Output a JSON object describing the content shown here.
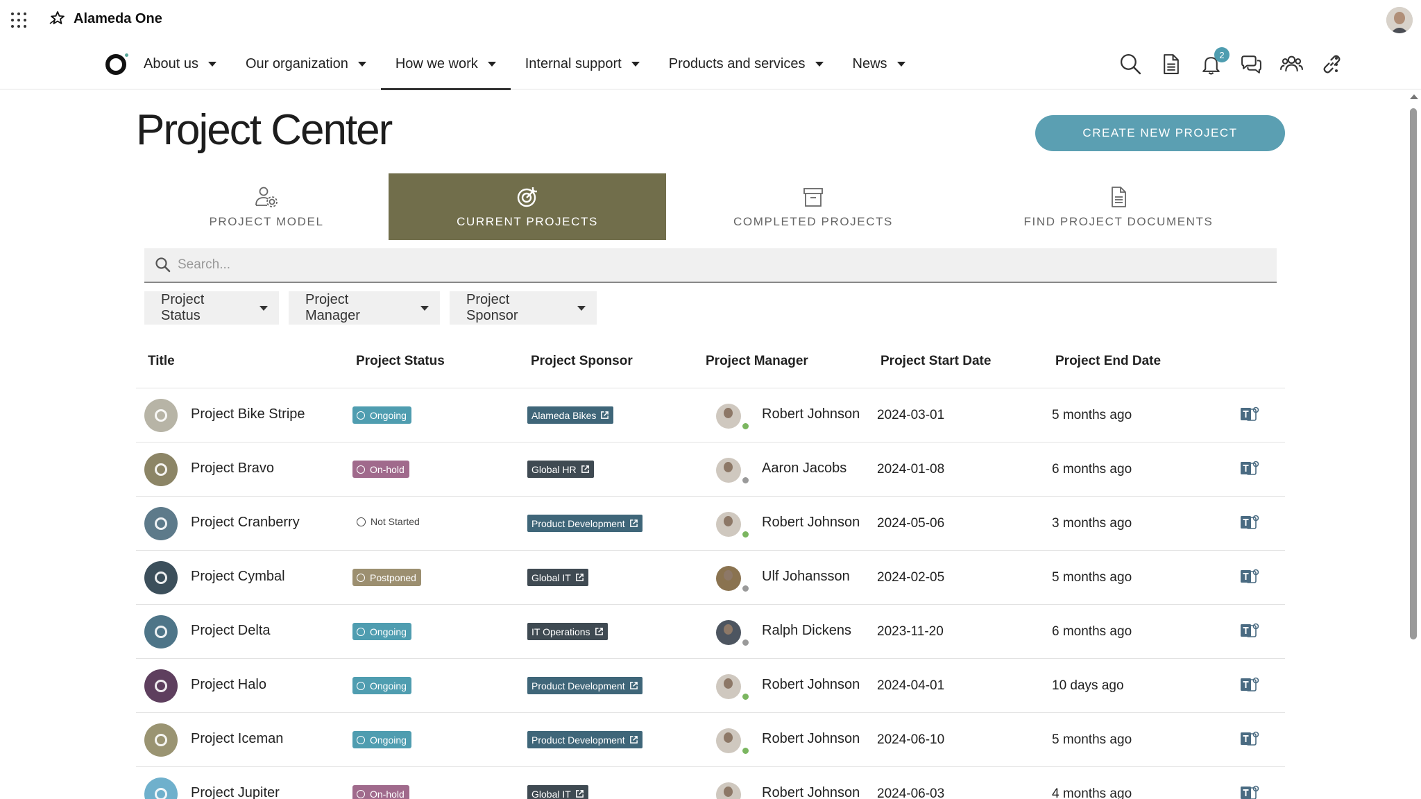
{
  "app": {
    "name": "Alameda One"
  },
  "nav": {
    "items": [
      {
        "label": "About us"
      },
      {
        "label": "Our organization"
      },
      {
        "label": "How we work"
      },
      {
        "label": "Internal support"
      },
      {
        "label": "Products and services"
      },
      {
        "label": "News"
      }
    ],
    "active_index": 2,
    "notification_count": "2"
  },
  "page": {
    "title": "Project Center",
    "create_button": "CREATE NEW PROJECT"
  },
  "tabs": [
    {
      "label": "PROJECT MODEL",
      "icon": "user-gear-icon"
    },
    {
      "label": "CURRENT PROJECTS",
      "icon": "target-icon"
    },
    {
      "label": "COMPLETED PROJECTS",
      "icon": "archive-box-icon"
    },
    {
      "label": "FIND PROJECT DOCUMENTS",
      "icon": "document-icon"
    }
  ],
  "active_tab": 1,
  "search": {
    "placeholder": "Search..."
  },
  "filters": [
    {
      "label": "Project Status"
    },
    {
      "label": "Project Manager"
    },
    {
      "label": "Project Sponsor"
    }
  ],
  "table": {
    "columns": [
      "Title",
      "Project Status",
      "Project Sponsor",
      "Project Manager",
      "Project Start Date",
      "Project End Date"
    ],
    "rows": [
      {
        "title": "Project Bike Stripe",
        "status": "Ongoing",
        "sponsor": "Alameda Bikes",
        "manager": "Robert Johnson",
        "start": "2024-03-01",
        "end": "5 months ago"
      },
      {
        "title": "Project Bravo",
        "status": "On-hold",
        "sponsor": "Global HR",
        "manager": "Aaron Jacobs",
        "start": "2024-01-08",
        "end": "6 months ago"
      },
      {
        "title": "Project Cranberry",
        "status": "Not Started",
        "sponsor": "Product Development",
        "manager": "Robert Johnson",
        "start": "2024-05-06",
        "end": "3 months ago"
      },
      {
        "title": "Project Cymbal",
        "status": "Postponed",
        "sponsor": "Global IT",
        "manager": "Ulf Johansson",
        "start": "2024-02-05",
        "end": "5 months ago"
      },
      {
        "title": "Project Delta",
        "status": "Ongoing",
        "sponsor": "IT Operations",
        "manager": "Ralph Dickens",
        "start": "2023-11-20",
        "end": "6 months ago"
      },
      {
        "title": "Project Halo",
        "status": "Ongoing",
        "sponsor": "Product Development",
        "manager": "Robert Johnson",
        "start": "2024-04-01",
        "end": "10 days ago"
      },
      {
        "title": "Project Iceman",
        "status": "Ongoing",
        "sponsor": "Product Development",
        "manager": "Robert Johnson",
        "start": "2024-06-10",
        "end": "5 months ago"
      },
      {
        "title": "Project Jupiter",
        "status": "On-hold",
        "sponsor": "Global IT",
        "manager": "Robert Johnson",
        "start": "2024-06-03",
        "end": "4 months ago"
      }
    ]
  },
  "colors": {
    "accent": "#5b9fb2",
    "active_tab": "#716e4b",
    "status_ongoing": "#4f9db0",
    "status_onhold": "#a06a8c",
    "status_postponed": "#9c8f70",
    "sponsor_pill": "#3f6679",
    "presence_available": "#7bb660",
    "presence_offline": "#9a9a9a"
  }
}
